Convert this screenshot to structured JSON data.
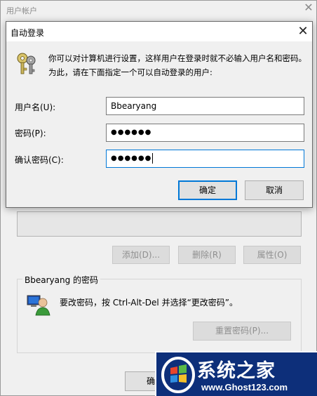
{
  "background_window": {
    "title": "用户帐户",
    "buttons": {
      "add": "添加(D)...",
      "remove": "删除(R)",
      "properties": "属性(O)"
    },
    "password_group": {
      "title": "Bbearyang 的密码",
      "hint": "要改密码，按 Ctrl-Alt-Del 并选择“更改密码”。",
      "reset_button": "重置密码(P)..."
    },
    "ok_button_partial": "确"
  },
  "dialog": {
    "title": "自动登录",
    "description": "你可以对计算机进行设置，这样用户在登录时就不必输入用户名和密码。为此，请在下面指定一个可以自动登录的用户:",
    "username_label": "用户名(U):",
    "username_value": "Bbearyang",
    "password_label": "密码(P):",
    "password_value": "●●●●●●",
    "confirm_label": "确认密码(C):",
    "confirm_value": "●●●●●●",
    "ok_button": "确定",
    "cancel_button": "取消"
  },
  "watermark": {
    "title": "系统之家",
    "url": "www.Ghost123.com"
  },
  "colors": {
    "accent": "#0078d7",
    "watermark_bg": "#0d2f7a"
  },
  "icons": {
    "keys": "keys-icon",
    "user": "user-computer-icon",
    "logo": "windows-logo-icon",
    "close": "close-icon"
  }
}
